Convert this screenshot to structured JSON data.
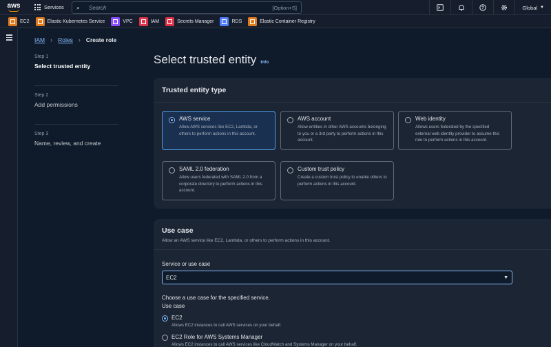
{
  "topnav": {
    "logo": "aws",
    "services_label": "Services",
    "search_placeholder": "Search",
    "search_shortcut": "[Option+S]",
    "region_label": "Global",
    "icons": [
      "cloudshell-icon",
      "bell-icon",
      "help-icon",
      "gear-icon"
    ]
  },
  "favorites": [
    {
      "label": "EC2",
      "color": "#e07b1f",
      "icon": "ec2-icon"
    },
    {
      "label": "Elastic Kubernetes Service",
      "color": "#e07b1f",
      "icon": "eks-icon"
    },
    {
      "label": "VPC",
      "color": "#8c4fff",
      "icon": "vpc-icon"
    },
    {
      "label": "IAM",
      "color": "#dd344c",
      "icon": "iam-icon"
    },
    {
      "label": "Secrets Manager",
      "color": "#dd344c",
      "icon": "secrets-manager-icon"
    },
    {
      "label": "RDS",
      "color": "#527fff",
      "icon": "rds-icon"
    },
    {
      "label": "Elastic Container Registry",
      "color": "#e07b1f",
      "icon": "ecr-icon"
    }
  ],
  "breadcrumb": {
    "item1": "IAM",
    "item2": "Roles",
    "current": "Create role"
  },
  "steps": [
    {
      "num": "Step 1",
      "title": "Select trusted entity"
    },
    {
      "num": "Step 2",
      "title": "Add permissions"
    },
    {
      "num": "Step 3",
      "title": "Name, review, and create"
    }
  ],
  "page": {
    "title": "Select trusted entity",
    "info": "Info"
  },
  "trusted_entity": {
    "heading": "Trusted entity type",
    "options": [
      {
        "title": "AWS service",
        "desc": "Allow AWS services like EC2, Lambda, or others to perform actions in this account.",
        "selected": true
      },
      {
        "title": "AWS account",
        "desc": "Allow entities in other AWS accounts belonging to you or a 3rd party to perform actions in this account.",
        "selected": false
      },
      {
        "title": "Web identity",
        "desc": "Allows users federated by the specified external web identity provider to assume this role to perform actions in this account.",
        "selected": false
      },
      {
        "title": "SAML 2.0 federation",
        "desc": "Allow users federated with SAML 2.0 from a corporate directory to perform actions in this account.",
        "selected": false
      },
      {
        "title": "Custom trust policy",
        "desc": "Create a custom trust policy to enable others to perform actions in this account.",
        "selected": false
      }
    ]
  },
  "use_case": {
    "heading": "Use case",
    "subheading": "Allow an AWS service like EC2, Lambda, or others to perform actions in this account.",
    "service_label": "Service or use case",
    "service_value": "EC2",
    "choose_label": "Choose a use case for the specified service.",
    "use_case_label": "Use case",
    "options": [
      {
        "title": "EC2",
        "desc": "Allows EC2 instances to call AWS services on your behalf.",
        "selected": true
      },
      {
        "title": "EC2 Role for AWS Systems Manager",
        "desc": "Allows EC2 instances to call AWS services like CloudWatch and Systems Manager on your behalf.",
        "selected": false
      }
    ]
  }
}
